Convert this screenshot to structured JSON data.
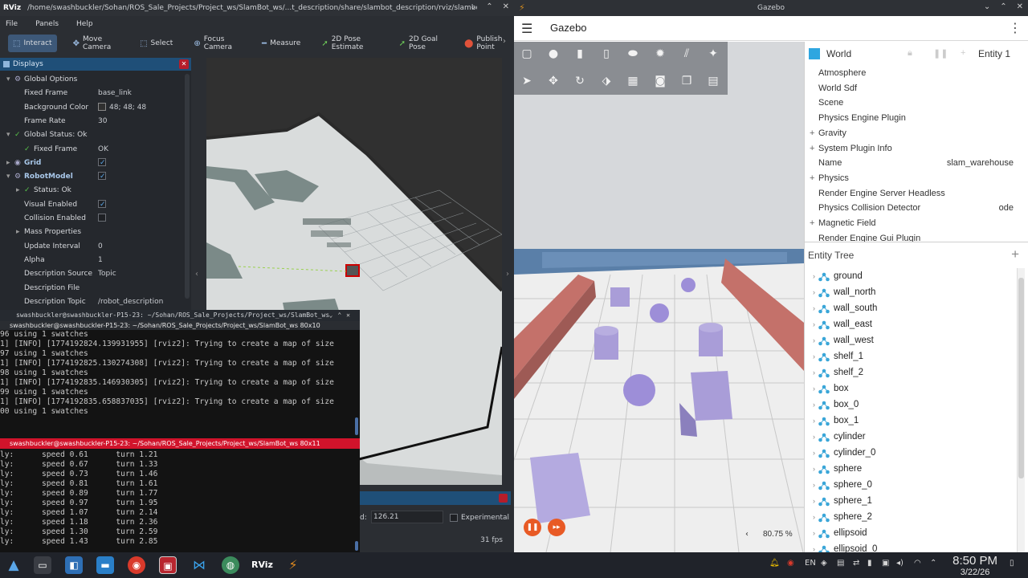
{
  "rviz": {
    "title": "/home/swashbuckler/Sohan/ROS_Sale_Projects/Project_ws/SlamBot_ws/...t_description/share/slambot_description/rviz/slambot.rviz* - RViz",
    "logo": "RViz",
    "menu": [
      "File",
      "Panels",
      "Help"
    ],
    "tools": [
      {
        "label": "Interact",
        "icon": "cursor-icon",
        "glyph": "⬚",
        "active": true
      },
      {
        "label": "Move Camera",
        "icon": "move-icon",
        "glyph": "✥"
      },
      {
        "label": "Select",
        "icon": "select-icon",
        "glyph": "⬚"
      },
      {
        "label": "Focus Camera",
        "icon": "focus-icon",
        "glyph": "⊕"
      },
      {
        "label": "Measure",
        "icon": "ruler-icon",
        "glyph": "━"
      },
      {
        "label": "2D Pose Estimate",
        "icon": "arrow-green-icon",
        "glyph": "➚"
      },
      {
        "label": "2D Goal Pose",
        "icon": "arrow-green-icon",
        "glyph": "➚"
      },
      {
        "label": "Publish Point",
        "icon": "pin-icon",
        "glyph": "⬤"
      }
    ],
    "displays_title": "Displays",
    "properties": [
      {
        "indent": 1,
        "arrow": "▾",
        "icon": "gear",
        "key": "Global Options",
        "value": ""
      },
      {
        "indent": 2,
        "key": "Fixed Frame",
        "value": "base_link"
      },
      {
        "indent": 2,
        "key": "Background Color",
        "value": "48; 48; 48",
        "swatch": true
      },
      {
        "indent": 2,
        "key": "Frame Rate",
        "value": "30"
      },
      {
        "indent": 1,
        "arrow": "▾",
        "icon": "check",
        "key": "Global Status: Ok",
        "value": ""
      },
      {
        "indent": 2,
        "icon": "check",
        "key": "Fixed Frame",
        "value": "OK"
      },
      {
        "indent": 1,
        "arrow": "▸",
        "icon": "grid",
        "key": "Grid",
        "value": "",
        "checkbox": true,
        "bold": true
      },
      {
        "indent": 1,
        "arrow": "▾",
        "icon": "robot",
        "key": "RobotModel",
        "value": "",
        "checkbox": true,
        "bold": true
      },
      {
        "indent": 2,
        "arrow": "▸",
        "icon": "check",
        "key": "Status: Ok",
        "value": ""
      },
      {
        "indent": 2,
        "key": "Visual Enabled",
        "value": "",
        "checkbox": true
      },
      {
        "indent": 2,
        "key": "Collision Enabled",
        "value": "",
        "checkbox": false
      },
      {
        "indent": 2,
        "arrow": "▸",
        "key": "Mass Properties",
        "value": ""
      },
      {
        "indent": 2,
        "key": "Update Interval",
        "value": "0"
      },
      {
        "indent": 2,
        "key": "Alpha",
        "value": "1"
      },
      {
        "indent": 2,
        "key": "Description Source",
        "value": "Topic"
      },
      {
        "indent": 2,
        "key": "Description File",
        "value": ""
      },
      {
        "indent": 2,
        "key": "Description Topic",
        "value": "/robot_description"
      }
    ],
    "time_label": "d:",
    "time_value": "126.21",
    "experimental": "Experimental",
    "fps": "31 fps"
  },
  "term1": {
    "window_title": "swashbuckler@swashbuckler-P15-23: ~/Sohan/ROS_Sale_Projects/Project_ws/SlamBot_ws",
    "tab": "swashbuckler@swashbuckler-P15-23: ~/Sohan/ROS_Sale_Projects/Project_ws/SlamBot_ws 80x10",
    "lines": [
      "96 using 1 swatches",
      "1] [INFO] [1774192824.139931955] [rviz2]: Trying to create a map of size",
      "97 using 1 swatches",
      "1] [INFO] [1774192825.130274308] [rviz2]: Trying to create a map of size",
      "98 using 1 swatches",
      "1] [INFO] [1774192835.146930305] [rviz2]: Trying to create a map of size",
      "99 using 1 swatches",
      "1] [INFO] [1774192835.658837035] [rviz2]: Trying to create a map of size",
      "00 using 1 swatches"
    ]
  },
  "term2": {
    "tab": "swashbuckler@swashbuckler-P15-23: ~/Sohan/ROS_Sale_Projects/Project_ws/SlamBot_ws 80x11",
    "lines": [
      "ly:      speed 0.61      turn 1.21",
      "ly:      speed 0.67      turn 1.33",
      "ly:      speed 0.73      turn 1.46",
      "ly:      speed 0.81      turn 1.61",
      "ly:      speed 0.89      turn 1.77",
      "ly:      speed 0.97      turn 1.95",
      "ly:      speed 1.07      turn 2.14",
      "ly:      speed 1.18      turn 2.36",
      "ly:      speed 1.30      turn 2.59",
      "ly:      speed 1.43      turn 2.85"
    ]
  },
  "gazebo": {
    "window_title": "Gazebo",
    "app_name": "Gazebo",
    "world_label": "World",
    "entity_label": "Entity 1",
    "world_props": [
      {
        "key": "Atmosphere",
        "value": "",
        "plus": false
      },
      {
        "key": "World Sdf",
        "value": "",
        "plus": false
      },
      {
        "key": "Scene",
        "value": "",
        "plus": false
      },
      {
        "key": "Physics Engine Plugin",
        "value": "",
        "plus": false
      },
      {
        "key": "Gravity",
        "value": "",
        "plus": true
      },
      {
        "key": "System Plugin Info",
        "value": "",
        "plus": true
      },
      {
        "key": "Name",
        "value": "slam_warehouse",
        "plus": false
      },
      {
        "key": "Physics",
        "value": "",
        "plus": true
      },
      {
        "key": "Render Engine Server Headless",
        "value": "",
        "plus": false
      },
      {
        "key": "Physics Collision Detector",
        "value": "ode",
        "plus": false
      },
      {
        "key": "Magnetic Field",
        "value": "",
        "plus": true
      },
      {
        "key": "Render Engine Gui Plugin",
        "value": "",
        "plus": false
      }
    ],
    "entity_tree_title": "Entity Tree",
    "entities": [
      "ground",
      "wall_north",
      "wall_south",
      "wall_east",
      "wall_west",
      "shelf_1",
      "shelf_2",
      "box",
      "box_0",
      "box_1",
      "cylinder",
      "cylinder_0",
      "sphere",
      "sphere_0",
      "sphere_1",
      "sphere_2",
      "ellipsoid",
      "ellipsoid_0"
    ],
    "zoom": "80.75 %"
  },
  "taskbar": {
    "time": "8:50 PM",
    "date": "3/22/26",
    "lang": "EN"
  }
}
